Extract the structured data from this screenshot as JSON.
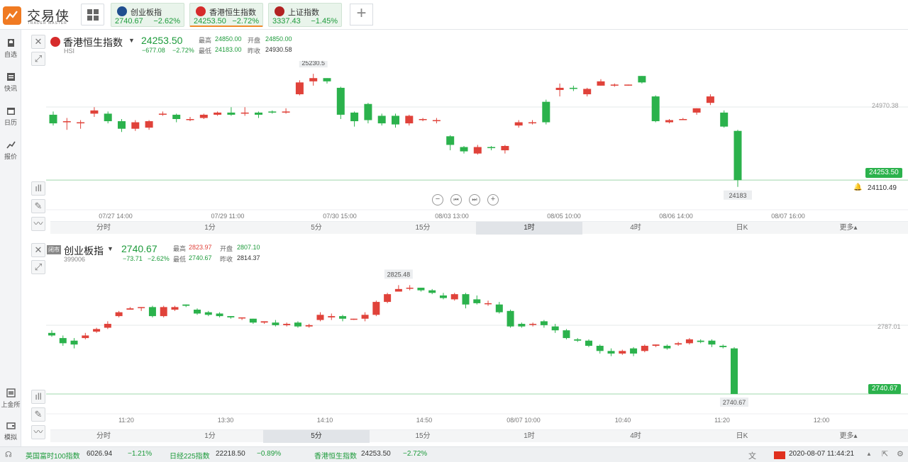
{
  "app": {
    "name": "交易侠",
    "subtitle": "TRADER MASTER"
  },
  "tabs": [
    {
      "name": "创业板指",
      "price": "2740.67",
      "change": "−2.62%",
      "flag_color": "#1f4e8f",
      "active": false
    },
    {
      "name": "香港恒生指数",
      "price": "24253.50",
      "change": "−2.72%",
      "flag_color": "#d62b2b",
      "active": true
    },
    {
      "name": "上证指数",
      "price": "3337.43",
      "change": "−1.45%",
      "flag_color": "#b22222",
      "active": false
    }
  ],
  "sidebar": [
    {
      "label": "自选",
      "icon": "bookmark-icon"
    },
    {
      "label": "快讯",
      "icon": "news-icon"
    },
    {
      "label": "日历",
      "icon": "calendar-icon"
    },
    {
      "label": "报价",
      "icon": "trend-icon"
    },
    {
      "label": "上金所",
      "icon": "exchange-icon"
    },
    {
      "label": "模拟",
      "icon": "wallet-icon"
    }
  ],
  "panel1": {
    "name": "香港恒生指数",
    "code": "HSI",
    "price": "24253.50",
    "change": "−677.08",
    "change_pct": "−2.72%",
    "stats": {
      "high_label": "最高",
      "high": "24850.00",
      "open_label": "开盘",
      "open": "24850.00",
      "low_label": "最低",
      "low": "24183.00",
      "prev_label": "昨收",
      "prev": "24930.58"
    },
    "right_level": "24970.38",
    "last_tag": "24253.50",
    "alert_value": "24110.49",
    "high_marker": "25230.5",
    "low_marker": "24183",
    "timeframes": [
      "分时",
      "1分",
      "5分",
      "15分",
      "1时",
      "4时",
      "日K",
      "更多▴"
    ],
    "active_tf": 4
  },
  "panel2": {
    "name": "创业板指",
    "status_badge": "闭市",
    "code": "399006",
    "price": "2740.67",
    "change": "−73.71",
    "change_pct": "−2.62%",
    "stats": {
      "high_label": "最高",
      "high": "2823.97",
      "open_label": "开盘",
      "open": "2807.10",
      "low_label": "最低",
      "low": "2740.67",
      "prev_label": "昨收",
      "prev": "2814.37"
    },
    "right_level": "2787.01",
    "last_tag": "2740.67",
    "high_marker": "2825.48",
    "low_marker": "2740.67",
    "timeframes": [
      "分时",
      "1分",
      "5分",
      "15分",
      "1时",
      "4时",
      "日K",
      "更多▴"
    ],
    "active_tf": 2
  },
  "chart_data": [
    {
      "type": "candlestick",
      "title": "香港恒生指数",
      "x_ticks": [
        "07/27 14:00",
        "07/29 11:00",
        "07/30 15:00",
        "08/03 13:00",
        "08/05 10:00",
        "08/06 14:00",
        "08/07 16:00"
      ],
      "ylim": [
        24070,
        25320
      ],
      "candles": [
        [
          24860,
          24780,
          24890,
          24760
        ],
        [
          24790,
          24800,
          24830,
          24720
        ],
        [
          24790,
          24790,
          24810,
          24730
        ],
        [
          24870,
          24900,
          24930,
          24840
        ],
        [
          24870,
          24800,
          24890,
          24780
        ],
        [
          24800,
          24730,
          24820,
          24700
        ],
        [
          24730,
          24790,
          24810,
          24710
        ],
        [
          24740,
          24800,
          24810,
          24720
        ],
        [
          24860,
          24870,
          24890,
          24850
        ],
        [
          24860,
          24820,
          24870,
          24790
        ],
        [
          24820,
          24820,
          24840,
          24800
        ],
        [
          24830,
          24860,
          24870,
          24820
        ],
        [
          24860,
          24880,
          24890,
          24850
        ],
        [
          24880,
          24860,
          24930,
          24850
        ],
        [
          24880,
          24880,
          24930,
          24850
        ],
        [
          24880,
          24860,
          24890,
          24830
        ],
        [
          24890,
          24880,
          24900,
          24870
        ],
        [
          24880,
          24890,
          24920,
          24870
        ],
        [
          25050,
          25160,
          25180,
          25040
        ],
        [
          25170,
          25200,
          25240,
          25130
        ],
        [
          25200,
          25170,
          25200,
          25150
        ],
        [
          25110,
          24860,
          25120,
          24820
        ],
        [
          24880,
          24800,
          24890,
          24750
        ],
        [
          24960,
          24810,
          24970,
          24780
        ],
        [
          24850,
          24780,
          24870,
          24760
        ],
        [
          24850,
          24770,
          24870,
          24740
        ],
        [
          24780,
          24850,
          24860,
          24760
        ],
        [
          24820,
          24820,
          24830,
          24800
        ],
        [
          24810,
          24810,
          24830,
          24780
        ],
        [
          24660,
          24580,
          24670,
          24530
        ],
        [
          24560,
          24520,
          24570,
          24500
        ],
        [
          24500,
          24560,
          24580,
          24490
        ],
        [
          24560,
          24550,
          24570,
          24530
        ],
        [
          24530,
          24570,
          24580,
          24500
        ],
        [
          24760,
          24790,
          24810,
          24740
        ],
        [
          24790,
          24790,
          24810,
          24770
        ],
        [
          24980,
          24790,
          25000,
          24770
        ],
        [
          25090,
          25110,
          25150,
          25030
        ],
        [
          25110,
          25100,
          25130,
          25080
        ],
        [
          25050,
          25100,
          25110,
          25030
        ],
        [
          25130,
          25170,
          25190,
          25130
        ],
        [
          25130,
          25140,
          25150,
          25120
        ],
        [
          25140,
          25140,
          25140,
          25130
        ],
        [
          25220,
          25160,
          25220,
          25150
        ],
        [
          25030,
          24800,
          25040,
          24790
        ],
        [
          24790,
          24810,
          24820,
          24780
        ],
        [
          24820,
          24820,
          24830,
          24810
        ],
        [
          24880,
          24920,
          24920,
          24860
        ],
        [
          24970,
          25030,
          25050,
          24950
        ],
        [
          24880,
          24750,
          24900,
          24740
        ],
        [
          24710,
          24253,
          24720,
          24190
        ]
      ]
    },
    {
      "type": "candlestick",
      "title": "创业板指",
      "x_ticks": [
        "11:20",
        "13:30",
        "14:10",
        "14:50",
        "08/07 10:00",
        "10:40",
        "11:20",
        "12:00"
      ],
      "ylim": [
        2733,
        2834
      ],
      "candles": [
        [
          2788,
          2786,
          2790,
          2785
        ],
        [
          2784,
          2780,
          2786,
          2778
        ],
        [
          2782,
          2779,
          2784,
          2776
        ],
        [
          2784,
          2786,
          2788,
          2783
        ],
        [
          2789,
          2791,
          2792,
          2788
        ],
        [
          2792,
          2795,
          2797,
          2791
        ],
        [
          2801,
          2804,
          2805,
          2800
        ],
        [
          2806,
          2807,
          2808,
          2806
        ],
        [
          2808,
          2808,
          2808,
          2805
        ],
        [
          2808,
          2801,
          2809,
          2800
        ],
        [
          2801,
          2808,
          2809,
          2800
        ],
        [
          2806,
          2808,
          2809,
          2805
        ],
        [
          2810,
          2809,
          2810,
          2808
        ],
        [
          2806,
          2803,
          2807,
          2802
        ],
        [
          2804,
          2802,
          2805,
          2801
        ],
        [
          2803,
          2801,
          2804,
          2800
        ],
        [
          2801,
          2800,
          2801,
          2799
        ],
        [
          2800,
          2800,
          2800,
          2798
        ],
        [
          2799,
          2796,
          2799,
          2795
        ],
        [
          2796,
          2797,
          2797,
          2795
        ],
        [
          2796,
          2794,
          2798,
          2793
        ],
        [
          2794,
          2795,
          2796,
          2793
        ],
        [
          2796,
          2793,
          2797,
          2792
        ],
        [
          2793,
          2794,
          2795,
          2792
        ],
        [
          2798,
          2802,
          2804,
          2797
        ],
        [
          2800,
          2801,
          2803,
          2798
        ],
        [
          2801,
          2799,
          2802,
          2797
        ],
        [
          2799,
          2799,
          2799,
          2798
        ],
        [
          2799,
          2802,
          2804,
          2797
        ],
        [
          2802,
          2812,
          2813,
          2801
        ],
        [
          2812,
          2818,
          2819,
          2811
        ],
        [
          2820,
          2822,
          2825,
          2820
        ],
        [
          2823,
          2823,
          2825,
          2821
        ],
        [
          2823,
          2821,
          2823,
          2820
        ],
        [
          2821,
          2819,
          2822,
          2818
        ],
        [
          2817,
          2815,
          2819,
          2814
        ],
        [
          2814,
          2818,
          2819,
          2813
        ],
        [
          2818,
          2810,
          2819,
          2807
        ],
        [
          2814,
          2811,
          2817,
          2810
        ],
        [
          2811,
          2811,
          2813,
          2809
        ],
        [
          2810,
          2804,
          2812,
          2803
        ],
        [
          2805,
          2793,
          2806,
          2792
        ],
        [
          2795,
          2793,
          2796,
          2792
        ],
        [
          2795,
          2795,
          2796,
          2793
        ],
        [
          2797,
          2794,
          2798,
          2792
        ],
        [
          2793,
          2790,
          2795,
          2788
        ],
        [
          2790,
          2784,
          2791,
          2783
        ],
        [
          2783,
          2782,
          2784,
          2781
        ],
        [
          2782,
          2778,
          2783,
          2777
        ],
        [
          2778,
          2774,
          2779,
          2772
        ],
        [
          2774,
          2772,
          2776,
          2770
        ],
        [
          2772,
          2774,
          2775,
          2771
        ],
        [
          2776,
          2772,
          2777,
          2770
        ],
        [
          2774,
          2778,
          2779,
          2773
        ],
        [
          2778,
          2779,
          2779,
          2777
        ],
        [
          2778,
          2776,
          2779,
          2775
        ],
        [
          2779,
          2780,
          2781,
          2778
        ],
        [
          2780,
          2783,
          2784,
          2779
        ],
        [
          2782,
          2781,
          2783,
          2780
        ],
        [
          2782,
          2779,
          2783,
          2777
        ],
        [
          2778,
          2777,
          2779,
          2776
        ],
        [
          2776,
          2740.67,
          2777,
          2740.67
        ]
      ]
    }
  ],
  "bottom_ticker": [
    {
      "name": "英国富时100指数",
      "price": "6026.94",
      "change": "−1.21%"
    },
    {
      "name": "日经225指数",
      "price": "22218.50",
      "change": "−0.89%"
    },
    {
      "name": "香港恒生指数",
      "price": "24253.50",
      "change": "−2.72%"
    }
  ],
  "datetime": "2020-08-07 11:44:21",
  "colors": {
    "up": "#e0423a",
    "down": "#2bb24c",
    "accent": "#f07a22"
  }
}
